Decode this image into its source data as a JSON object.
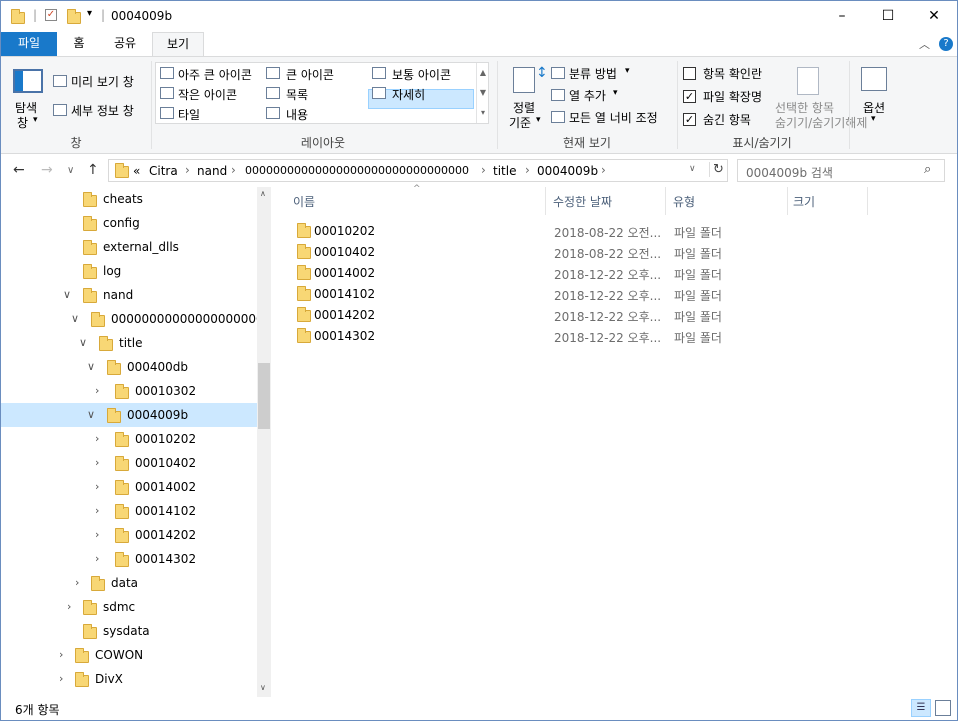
{
  "window": {
    "title": "0004009b",
    "controls": {
      "minimize": "–",
      "maximize": "☐",
      "close": "✕"
    }
  },
  "ribbon_tabs": [
    {
      "label": "파일"
    },
    {
      "label": "홈"
    },
    {
      "label": "공유"
    },
    {
      "label": "보기"
    }
  ],
  "ribbon": {
    "pane": {
      "nav_pane_label_1": "탐색",
      "nav_pane_label_2": "창",
      "preview_label": "미리 보기 창",
      "details_label": "세부 정보 창",
      "group_label": "창"
    },
    "layout": {
      "items": [
        "아주 큰 아이콘",
        "큰 아이콘",
        "보통 아이콘",
        "작은 아이콘",
        "목록",
        "자세히",
        "타일",
        "내용"
      ],
      "group_label": "레이아웃"
    },
    "current_view": {
      "sort_label_1": "정렬",
      "sort_label_2": "기준",
      "group_by": "분류 방법",
      "add_column": "열 추가",
      "size_all_columns": "모든 열 너비 조정",
      "group_label": "현재 보기"
    },
    "show_hide": {
      "item_checkboxes": "항목 확인란",
      "file_extensions": "파일 확장명",
      "hidden_items": "숨긴 항목",
      "hide_selected_1": "선택한 항목",
      "hide_selected_2": "숨기기/숨기기해제",
      "group_label": "표시/숨기기",
      "checks": {
        "item_checkboxes": false,
        "file_extensions": true,
        "hidden_items": true
      }
    },
    "options": {
      "label": "옵션"
    }
  },
  "address": {
    "prefix": "«",
    "crumbs": [
      "Citra",
      "nand",
      "00000000000000000000000000000000",
      "title",
      "0004009b"
    ],
    "search_placeholder": "0004009b 검색"
  },
  "tree": [
    {
      "label": "cheats",
      "expanded": null
    },
    {
      "label": "config",
      "expanded": null
    },
    {
      "label": "external_dlls",
      "expanded": null
    },
    {
      "label": "log",
      "expanded": null
    },
    {
      "label": "nand",
      "expanded": true
    },
    {
      "label": "00000000000000000000000000000000",
      "expanded": true
    },
    {
      "label": "title",
      "expanded": true
    },
    {
      "label": "000400db",
      "expanded": true
    },
    {
      "label": "00010302",
      "expanded": false
    },
    {
      "label": "0004009b",
      "expanded": true,
      "selected": true
    },
    {
      "label": "00010202",
      "expanded": false
    },
    {
      "label": "00010402",
      "expanded": false
    },
    {
      "label": "00014002",
      "expanded": false
    },
    {
      "label": "00014102",
      "expanded": false
    },
    {
      "label": "00014202",
      "expanded": false
    },
    {
      "label": "00014302",
      "expanded": false
    },
    {
      "label": "data",
      "expanded": false
    },
    {
      "label": "sdmc",
      "expanded": false
    },
    {
      "label": "sysdata",
      "expanded": null
    },
    {
      "label": "COWON",
      "expanded": false
    },
    {
      "label": "DivX",
      "expanded": false
    }
  ],
  "columns": {
    "name": "이름",
    "modified": "수정한 날짜",
    "type": "유형",
    "size": "크기"
  },
  "files": [
    {
      "name": "00010202",
      "modified": "2018-08-22 오전...",
      "type": "파일 폴더"
    },
    {
      "name": "00010402",
      "modified": "2018-08-22 오전...",
      "type": "파일 폴더"
    },
    {
      "name": "00014002",
      "modified": "2018-12-22 오후...",
      "type": "파일 폴더"
    },
    {
      "name": "00014102",
      "modified": "2018-12-22 오후...",
      "type": "파일 폴더"
    },
    {
      "name": "00014202",
      "modified": "2018-12-22 오후...",
      "type": "파일 폴더"
    },
    {
      "name": "00014302",
      "modified": "2018-12-22 오후...",
      "type": "파일 폴더"
    }
  ],
  "status": {
    "count": "6개 항목"
  },
  "colors": {
    "accent": "#1979ca",
    "selection": "#cce8ff",
    "folder": "#f8d775"
  }
}
